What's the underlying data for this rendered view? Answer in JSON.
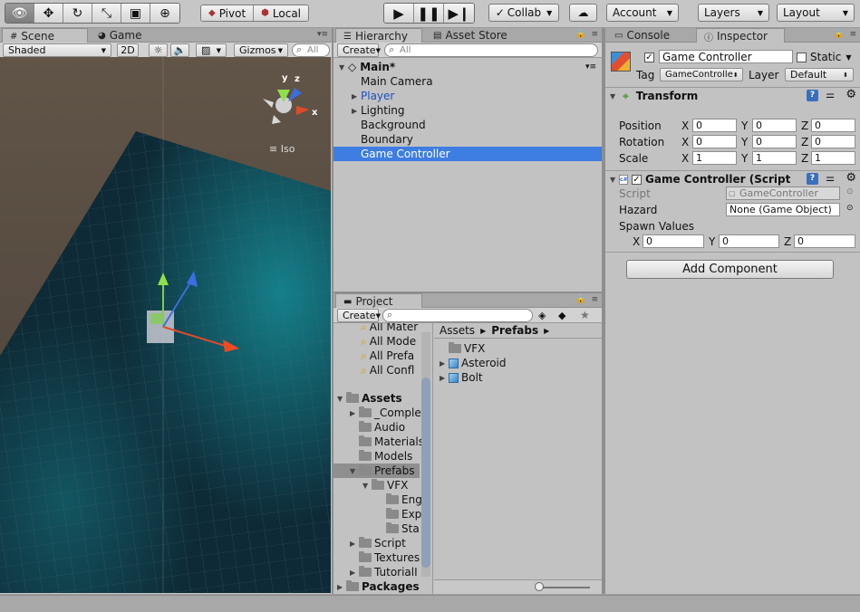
{
  "toolbar": {
    "tools": [
      "view-tool",
      "move-tool",
      "rotate-tool",
      "scale-tool",
      "rect-tool",
      "transform-tool"
    ],
    "pivot_label": "Pivot",
    "local_label": "Local",
    "collab_label": "Collab",
    "account_label": "Account",
    "layers_label": "Layers",
    "layout_label": "Layout"
  },
  "scene": {
    "tab_scene": "Scene",
    "tab_game": "Game",
    "shading": "Shaded",
    "mode_2d": "2D",
    "gizmos": "Gizmos",
    "search_placeholder": "All",
    "iso_label": "Iso",
    "axis_y": "y",
    "axis_z": "z",
    "axis_x": "x"
  },
  "hierarchy": {
    "tab": "Hierarchy",
    "tab_asset_store": "Asset Store",
    "create_label": "Create",
    "search_placeholder": "All",
    "scene_name": "Main*",
    "items": [
      {
        "label": "Main Camera",
        "expandable": false,
        "prefab": false
      },
      {
        "label": "Player",
        "expandable": true,
        "prefab": true
      },
      {
        "label": "Lighting",
        "expandable": true,
        "prefab": false
      },
      {
        "label": "Background",
        "expandable": false,
        "prefab": false
      },
      {
        "label": "Boundary",
        "expandable": false,
        "prefab": false
      },
      {
        "label": "Game Controller",
        "expandable": false,
        "prefab": false
      }
    ]
  },
  "project": {
    "tab": "Project",
    "create_label": "Create",
    "favorites": [
      "All Mater",
      "All Mode",
      "All Prefa",
      "All Confl"
    ],
    "assets_label": "Assets",
    "tree": [
      {
        "label": "_Comple",
        "depth": 1,
        "arrow": "right"
      },
      {
        "label": "Audio",
        "depth": 1,
        "arrow": ""
      },
      {
        "label": "Materials",
        "depth": 1,
        "arrow": ""
      },
      {
        "label": "Models",
        "depth": 1,
        "arrow": ""
      },
      {
        "label": "Prefabs",
        "depth": 1,
        "arrow": "down"
      },
      {
        "label": "VFX",
        "depth": 2,
        "arrow": "down"
      },
      {
        "label": "Eng",
        "depth": 3,
        "arrow": ""
      },
      {
        "label": "Exp",
        "depth": 3,
        "arrow": ""
      },
      {
        "label": "Sta",
        "depth": 3,
        "arrow": ""
      },
      {
        "label": "Script",
        "depth": 1,
        "arrow": "right"
      },
      {
        "label": "Textures",
        "depth": 1,
        "arrow": ""
      },
      {
        "label": "TutorialI",
        "depth": 1,
        "arrow": "right"
      }
    ],
    "packages_label": "Packages",
    "breadcrumb_root": "Assets",
    "breadcrumb_current": "Prefabs",
    "contents": [
      {
        "label": "VFX",
        "type": "folder"
      },
      {
        "label": "Asteroid",
        "type": "prefab"
      },
      {
        "label": "Bolt",
        "type": "prefab"
      }
    ]
  },
  "inspector": {
    "tab_console": "Console",
    "tab_inspector": "Inspector",
    "object_name": "Game Controller",
    "static_label": "Static",
    "tag_label": "Tag",
    "tag_value": "GameControlle",
    "layer_label": "Layer",
    "layer_value": "Default",
    "transform": {
      "title": "Transform",
      "position_label": "Position",
      "rotation_label": "Rotation",
      "scale_label": "Scale",
      "axis_x": "X",
      "axis_y": "Y",
      "axis_z": "Z",
      "position": [
        "0",
        "0",
        "0"
      ],
      "rotation": [
        "0",
        "0",
        "0"
      ],
      "scale": [
        "1",
        "1",
        "1"
      ]
    },
    "script_component": {
      "title": "Game Controller (Script",
      "script_label": "Script",
      "script_value": "GameController",
      "hazard_label": "Hazard",
      "hazard_value": "None (Game Object)",
      "spawn_label": "Spawn Values",
      "spawn_x": "0",
      "spawn_y": "0",
      "spawn_z": "0"
    },
    "add_component_label": "Add Component"
  }
}
